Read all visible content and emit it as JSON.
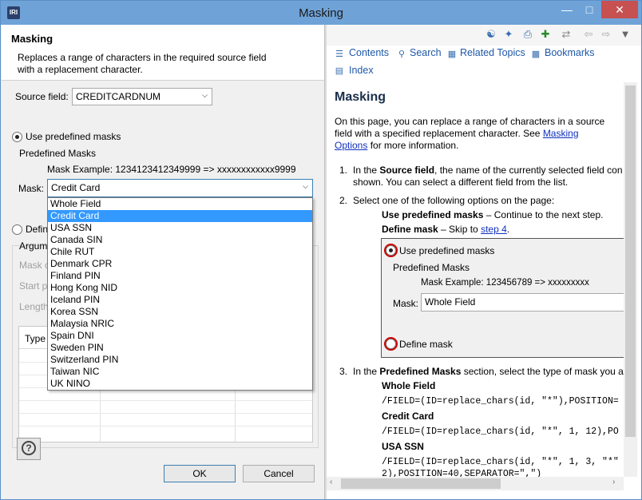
{
  "window": {
    "title": "Masking",
    "app_icon": "IRI"
  },
  "wizard": {
    "title": "Masking",
    "description": "Replaces a range of characters in the required source field with a replacement character.",
    "source_field_label": "Source field:",
    "source_field_value": "CREDITCARDNUM",
    "use_predefined_label": "Use predefined masks",
    "predefined_group_label": "Predefined Masks",
    "mask_example": "Mask Example: 1234123412349999 => xxxxxxxxxxxx9999",
    "mask_label": "Mask:",
    "mask_value": "Credit Card",
    "define_label": "Defin",
    "arguments_label": "Argum",
    "mask_char_label": "Mask c",
    "start_label": "Start p",
    "length_label": "Length",
    "table_col_type": "Type",
    "ok_label": "OK",
    "cancel_label": "Cancel"
  },
  "mask_options": [
    "Whole Field",
    "Credit Card",
    "USA SSN",
    "Canada SIN",
    "Chile RUT",
    "Denmark CPR",
    "Finland PIN",
    "Hong Kong NID",
    "Iceland PIN",
    "Korea SSN",
    "Malaysia NRIC",
    "Spain DNI",
    "Sweden PIN",
    "Switzerland PIN",
    "Taiwan NIC",
    "UK NINO"
  ],
  "mask_selected_index": 1,
  "help": {
    "tabs": {
      "contents": "Contents",
      "search": "Search",
      "related": "Related Topics",
      "bookmarks": "Bookmarks",
      "index": "Index"
    },
    "heading": "Masking",
    "intro_1": "On this page, you can replace a range of characters in a source",
    "intro_2a": "field with a specified replacement character. See ",
    "intro_link_1": "Masking",
    "intro_link_2": "Options",
    "intro_3": " for more information.",
    "step1_num": "1.",
    "step1_a": "In the ",
    "step1_b": "Source field",
    "step1_c": ", the name of the currently selected field con",
    "step1_d": "shown. You can select a different field from the list.",
    "step2_num": "2.",
    "step2": "Select one of the following options on the page:",
    "opt1_b": "Use predefined masks",
    "opt1_t": " – Continue to the next step.",
    "opt2_b": "Define mask",
    "opt2_t": " – Skip to ",
    "opt2_link": "step 4",
    "opt2_end": ".",
    "shot_use": "Use predefined masks",
    "shot_group": "Predefined Masks",
    "shot_example": "Mask Example: 123456789 => xxxxxxxxx",
    "shot_mask_label": "Mask:",
    "shot_mask_value": "Whole Field",
    "shot_define": "Define mask",
    "step3_num": "3.",
    "step3_a": "In the ",
    "step3_b": "Predefined Masks",
    "step3_c": " section, select the type of mask you a",
    "wf_title": "Whole Field",
    "wf_code": "/FIELD=(ID=replace_chars(id, \"*\"),POSITION=",
    "cc_title": "Credit Card",
    "cc_code": "/FIELD=(ID=replace_chars(id, \"*\", 1, 12),PO",
    "ssn_title": "USA SSN",
    "ssn_code_1": "/FIELD=(ID=replace_chars(id, \"*\", 1, 3, \"*\"",
    "ssn_code_2": "2),POSITION=40,SEPARATOR=\",\")"
  }
}
